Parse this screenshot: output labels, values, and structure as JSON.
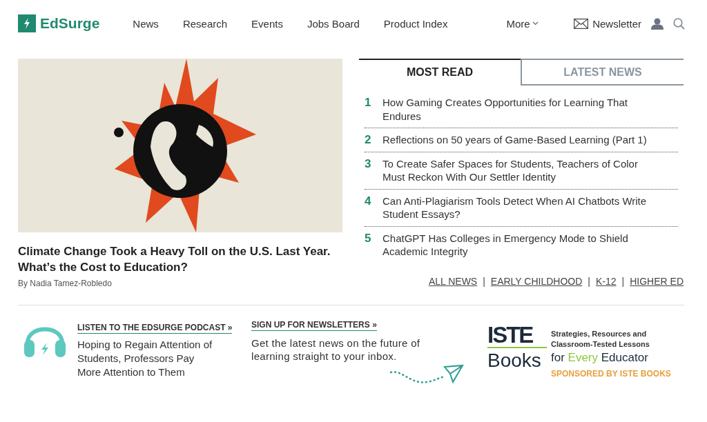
{
  "header": {
    "logo": "EdSurge",
    "nav": [
      {
        "label": "News"
      },
      {
        "label": "Research"
      },
      {
        "label": "Events"
      },
      {
        "label": "Jobs Board"
      },
      {
        "label": "Product Index"
      }
    ],
    "more": "More",
    "newsletter": "Newsletter"
  },
  "feature": {
    "headline": "Climate Change Took a Heavy Toll on the U.S. Last Year. What’s the Cost to Education?",
    "byline": "By Nadia Tamez-Robledo"
  },
  "tabs": [
    {
      "label": "MOST READ",
      "selected": true
    },
    {
      "label": "LATEST NEWS",
      "selected": false
    }
  ],
  "most_read": [
    {
      "rank": "1",
      "title": "How Gaming Creates Opportunities for Learning That Endures"
    },
    {
      "rank": "2",
      "title": "Reflections on 50 years of Game-Based Learning (Part 1)"
    },
    {
      "rank": "3",
      "title": "To Create Safer Spaces for Students, Teachers of Color Must Reckon With Our Settler Identity"
    },
    {
      "rank": "4",
      "title": "Can Anti-Plagiarism Tools Detect When AI Chatbots Write Student Essays?"
    },
    {
      "rank": "5",
      "title": "ChatGPT Has Colleges in Emergency Mode to Shield Academic Integrity"
    }
  ],
  "category_links": [
    {
      "label": "ALL NEWS"
    },
    {
      "label": "EARLY CHILDHOOD"
    },
    {
      "label": "K-12"
    },
    {
      "label": "HIGHER ED"
    }
  ],
  "separators": [
    "|",
    "|",
    "|"
  ],
  "podcast": {
    "label": "LISTEN TO THE EDSURGE PODCAST »",
    "title": "Hoping to Regain Attention of Students, Professors Pay More Attention to Them"
  },
  "newsletter_promo": {
    "label": "SIGN UP FOR NEWSLETTERS »",
    "text": "Get the latest news on the future of learning straight to your inbox."
  },
  "ad": {
    "logo_top": "ISTE",
    "logo_bottom": "Books",
    "tagline": "Strategies, Resources and Classroom-Tested Lessons",
    "slogan_before": "for",
    "slogan_highlight": "Every",
    "slogan_after": "Educator",
    "sponsor": "SPONSORED BY ISTE BOOKS"
  }
}
